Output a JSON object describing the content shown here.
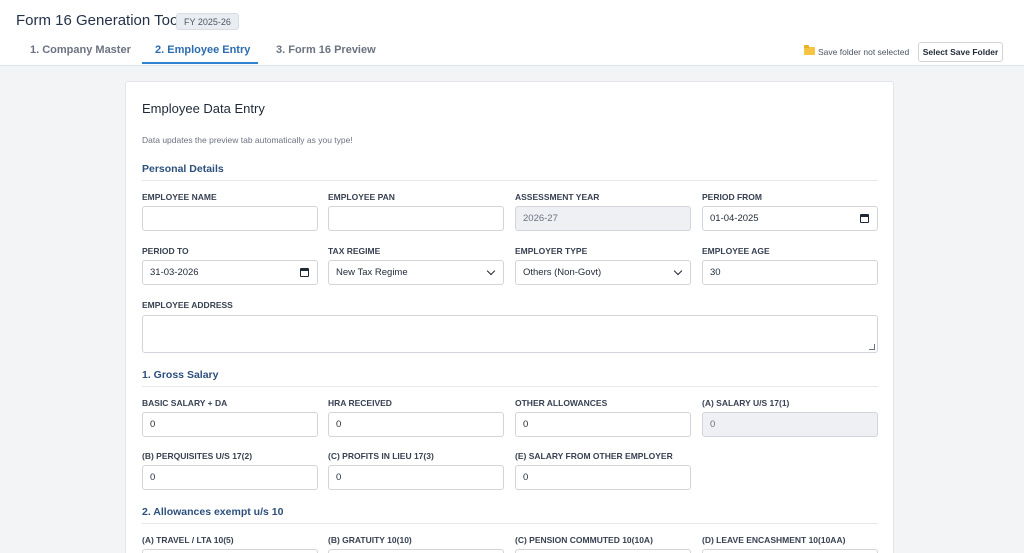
{
  "header": {
    "title": "Form 16 Generation Tool",
    "fy_badge": "FY 2025-26",
    "tabs": [
      {
        "label": "1. Company Master"
      },
      {
        "label": "2. Employee Entry"
      },
      {
        "label": "3. Form 16 Preview"
      }
    ],
    "active_tab": 1,
    "save_status": "Save folder not selected",
    "save_button": "Select Save Folder",
    "icons": {
      "folder": "folder-icon"
    }
  },
  "form": {
    "title": "Employee Data Entry",
    "hint": "Data updates the preview tab automatically as you type!",
    "personal": {
      "title": "Personal Details",
      "employee_name": {
        "label": "Employee Name",
        "value": ""
      },
      "employee_pan": {
        "label": "Employee PAN",
        "value": ""
      },
      "assessment_year": {
        "label": "Assessment Year",
        "value": "2026-27"
      },
      "period_from": {
        "label": "Period From",
        "value": "01-04-2025"
      },
      "period_to": {
        "label": "Period To",
        "value": "31-03-2026"
      },
      "tax_regime": {
        "label": "Tax Regime",
        "value": "New Tax Regime"
      },
      "employer_type": {
        "label": "Employer Type",
        "value": "Others (Non-Govt)"
      },
      "employee_age": {
        "label": "Employee Age",
        "value": "30"
      },
      "employee_address": {
        "label": "Employee Address",
        "value": ""
      }
    },
    "gross_salary": {
      "title": "1. Gross Salary",
      "basic_da": {
        "label": "Basic Salary + DA",
        "value": "0"
      },
      "hra": {
        "label": "HRA Received",
        "value": "0"
      },
      "other_allowances": {
        "label": "Other Allowances",
        "value": "0"
      },
      "salary_17_1": {
        "label": "(A) Salary u/s 17(1)",
        "value": "0"
      },
      "perquisites": {
        "label": "(B) Perquisites u/s 17(2)",
        "value": "0"
      },
      "profits_lieu": {
        "label": "(C) Profits in lieu 17(3)",
        "value": "0"
      },
      "other_employer": {
        "label": "(E) Salary from other employer",
        "value": "0"
      }
    },
    "exempt": {
      "title": "2. Allowances exempt u/s 10",
      "travel": {
        "label": "(A) Travel / LTA 10(5)"
      },
      "gratuity": {
        "label": "(B) Gratuity 10(10)"
      },
      "pension": {
        "label": "(C) Pension commuted 10(10A)"
      },
      "leave": {
        "label": "(D) Leave encashment 10(10AA)"
      }
    }
  }
}
